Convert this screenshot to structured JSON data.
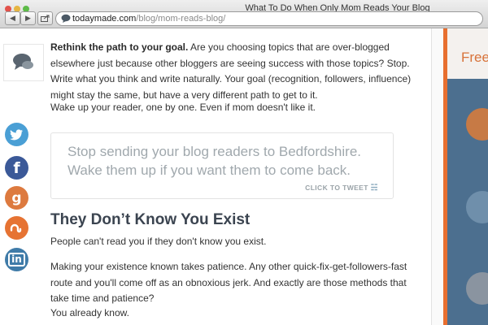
{
  "browser": {
    "window_title": "What To Do When Only Mom Reads Your Blog",
    "url_domain": "todaymade.com",
    "url_path": "/blog/mom-reads-blog/",
    "back_icon": "triangle-left",
    "forward_icon": "triangle-right",
    "share_icon": "share-box"
  },
  "social": [
    {
      "name": "twitter",
      "color": "#4a9fd5",
      "glyph": "t"
    },
    {
      "name": "facebook",
      "color": "#3b5998",
      "glyph": "f"
    },
    {
      "name": "googleplus",
      "color": "#dd7a3f",
      "glyph": "g"
    },
    {
      "name": "stumbleupon",
      "color": "#e67333",
      "glyph": "su"
    },
    {
      "name": "linkedin",
      "color": "#3f7ba8",
      "glyph": "in"
    }
  ],
  "article": {
    "p1_bold": "Rethink the path to your goal.",
    "p1_rest": " Are you choosing topics that are over-blogged elsewhere just because other bloggers are seeing success with those topics? Stop. Write what you think and write naturally. Your goal (recognition, followers, influence) might stay the same, but have a very different path to get to it.",
    "p2": "Wake up your reader, one by one. Even if mom doesn't like it.",
    "quote": "Stop sending your blog readers to Bedfordshire. Wake them up if you want them to come back.",
    "click_to_tweet": "CLICK TO TWEET",
    "heading": "They Don’t Know You Exist",
    "p3": "People can't read you if they don't know you exist.",
    "p4": "Making your existence known takes patience. Any other quick-fix-get-followers-fast route and you'll come off as an obnoxious jerk. And exactly are those methods that take time and patience?",
    "p5": "You already know."
  },
  "sidebar_right": {
    "label": "Free",
    "accent": "#e86f2f"
  }
}
